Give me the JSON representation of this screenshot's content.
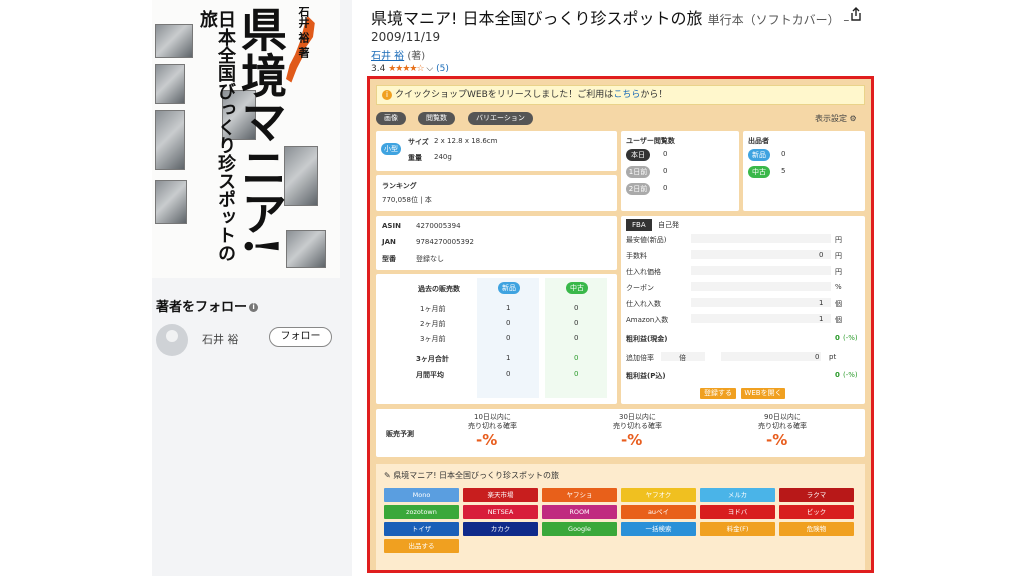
{
  "book": {
    "title": "県境マニア! 日本全国びっくり珍スポットの旅",
    "binding": "単行本（ソフトカバー） –",
    "date": "2009/11/19",
    "author": "石井 裕",
    "author_role": "(著)",
    "rating": "3.4",
    "stars": "★★★★☆",
    "rating_count": "(5)",
    "cover_main": "県境マニア!",
    "cover_sub": "日本全国びっくり珍スポットの旅",
    "cover_author": "石井 裕 著"
  },
  "left": {
    "follow_heading": "著者をフォロー",
    "author_name": "石井 裕",
    "follow_button": "フォロー"
  },
  "panel": {
    "notice": "クイックショップWEBをリリースしました！ご利用は",
    "notice_link": "こちら",
    "notice_tail": "から！",
    "tags": [
      "画像",
      "閲覧数",
      "バリエーション"
    ],
    "display_settings": "表示設定",
    "size_badge": "小型",
    "size_label": "サイズ",
    "size_value": "2 x 12.8 x 18.6cm",
    "weight_label": "重量",
    "weight_value": "240g",
    "ranking_label": "ランキング",
    "ranking_value": "770,058位 | 本",
    "user_views_label": "ユーザー閲覧数",
    "views": [
      {
        "label": "本日",
        "value": "0"
      },
      {
        "label": "1日前",
        "value": "0"
      },
      {
        "label": "2日前",
        "value": "0"
      }
    ],
    "sellers_label": "出品者",
    "sellers": [
      {
        "label": "新品",
        "value": "0"
      },
      {
        "label": "中古",
        "value": "5"
      }
    ],
    "asin_label": "ASIN",
    "asin_value": "4270005394",
    "jan_label": "JAN",
    "jan_value": "9784270005392",
    "model_label": "型番",
    "model_value": "登録なし",
    "sales_header": "過去の販売数",
    "sales_new": "新品",
    "sales_used": "中古",
    "sales_rows": [
      {
        "label": "1ヶ月前",
        "new": "1",
        "used": "0"
      },
      {
        "label": "2ヶ月前",
        "new": "0",
        "used": "0"
      },
      {
        "label": "3ヶ月前",
        "new": "0",
        "used": "0"
      },
      {
        "label": "3ヶ月合計",
        "new": "1",
        "used": "0"
      },
      {
        "label": "月間平均",
        "new": "0",
        "used": "0"
      }
    ],
    "fba_tab": "FBA",
    "self_tab": "自己発",
    "calc_rows": [
      {
        "label": "最安値(新品)",
        "value": "",
        "unit": "円"
      },
      {
        "label": "手数料",
        "value": "0",
        "unit": "円"
      },
      {
        "label": "仕入れ価格",
        "value": "",
        "unit": "円"
      },
      {
        "label": "クーポン",
        "value": "",
        "unit": "%"
      },
      {
        "label": "仕入れ入数",
        "value": "1",
        "unit": "個"
      },
      {
        "label": "Amazon入数",
        "value": "1",
        "unit": "個"
      }
    ],
    "profit_label": "粗利益(現金)",
    "profit_value": "0",
    "profit_pct": "(-%)",
    "extra_rate_label": "追加倍率",
    "extra_rate_unit": "倍",
    "extra_rate_value": "0",
    "extra_rate_pt": "pt",
    "profit_p_label": "粗利益(P込)",
    "profit_p_value": "0",
    "profit_p_pct": "(-%)",
    "register_btn": "登録する",
    "web_btn": "WEBを開く",
    "forecast_label": "販売予測",
    "forecasts": [
      {
        "label1": "10日以内に",
        "label2": "売り切れる確率",
        "value": "-%"
      },
      {
        "label1": "30日以内に",
        "label2": "売り切れる確率",
        "value": "-%"
      },
      {
        "label1": "90日以内に",
        "label2": "売り切れる確率",
        "value": "-%"
      }
    ],
    "bottom_title": "県境マニア! 日本全国びっくり珍スポットの旅",
    "shops": [
      {
        "label": "Mono",
        "color": "#5a9ee0"
      },
      {
        "label": "楽天市場",
        "color": "#c81e1e"
      },
      {
        "label": "ヤフショ",
        "color": "#e8601a"
      },
      {
        "label": "ヤフオク",
        "color": "#f0c020"
      },
      {
        "label": "メルカ",
        "color": "#4ab4e8"
      },
      {
        "label": "ラクマ",
        "color": "#b81818"
      },
      {
        "label": "zozotown",
        "color": "#3aa83a"
      },
      {
        "label": "NETSEA",
        "color": "#d81e3a"
      },
      {
        "label": "ROOM",
        "color": "#c02a80"
      },
      {
        "label": "auペイ",
        "color": "#e8601a"
      },
      {
        "label": "ヨドバ",
        "color": "#d81e1e"
      },
      {
        "label": "ビック",
        "color": "#d81e1e"
      },
      {
        "label": "トイザ",
        "color": "#1a5fb8"
      },
      {
        "label": "カカク",
        "color": "#102a8a"
      },
      {
        "label": "Google",
        "color": "#3aa83a"
      },
      {
        "label": "一括検索",
        "color": "#2a90d8"
      },
      {
        "label": "料金(F)",
        "color": "#f0a020"
      },
      {
        "label": "危険物",
        "color": "#f0a020"
      },
      {
        "label": "出品する",
        "color": "#f0a020"
      }
    ]
  }
}
